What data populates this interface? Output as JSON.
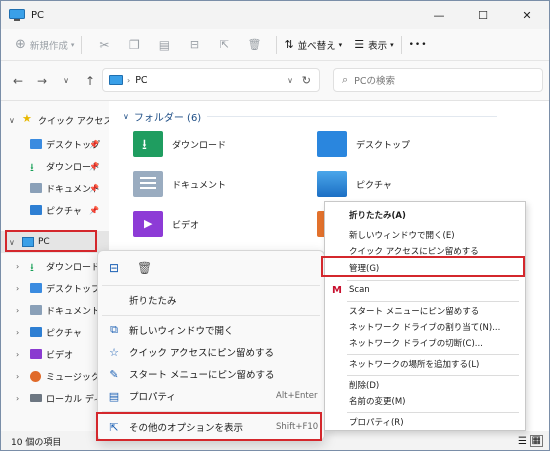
{
  "window": {
    "title": "PC",
    "minimize": "—",
    "maximize": "☐",
    "close": "✕"
  },
  "toolbar": {
    "new_label": "新規作成",
    "sort_label": "並べ替え",
    "view_label": "表示",
    "more_label": "•••"
  },
  "address": {
    "path": "PC",
    "search_placeholder": "PCの検索"
  },
  "nav": {
    "quick_access": "クイック アクセス",
    "items": [
      "デスクトップ",
      "ダウンロード",
      "ドキュメント",
      "ピクチャ"
    ],
    "pc": "PC",
    "pc_items": [
      "ダウンロード",
      "デスクトップ",
      "ドキュメント",
      "ピクチャ",
      "ビデオ",
      "ミュージック",
      "ローカル ディスク"
    ]
  },
  "main": {
    "group_header": "フォルダー (6)",
    "folders": [
      "ダウンロード",
      "デスクトップ",
      "ドキュメント",
      "ピクチャ",
      "ビデオ"
    ]
  },
  "status": {
    "count": "10 個の項目"
  },
  "context_menu": {
    "collapse": "折りたたみ",
    "open_new_window": "新しいウィンドウで開く",
    "pin_quick_access": "クイック アクセスにピン留めする",
    "pin_start": "スタート メニューにピン留めする",
    "properties": "プロパティ",
    "properties_shortcut": "Alt+Enter",
    "more_options": "その他のオプションを表示",
    "more_options_shortcut": "Shift+F10"
  },
  "legacy_menu": {
    "items": [
      "折りたたみ(A)",
      "新しいウィンドウで開く(E)",
      "クイック アクセスにピン留めする",
      "管理(G)",
      "Scan",
      "スタート メニューにピン留めする",
      "ネットワーク ドライブの割り当て(N)...",
      "ネットワーク ドライブの切断(C)...",
      "ネットワークの場所を追加する(L)",
      "削除(D)",
      "名前の変更(M)",
      "プロパティ(R)"
    ]
  },
  "colors": {
    "highlight": "#d4272c",
    "accent": "#1a5fb4"
  }
}
